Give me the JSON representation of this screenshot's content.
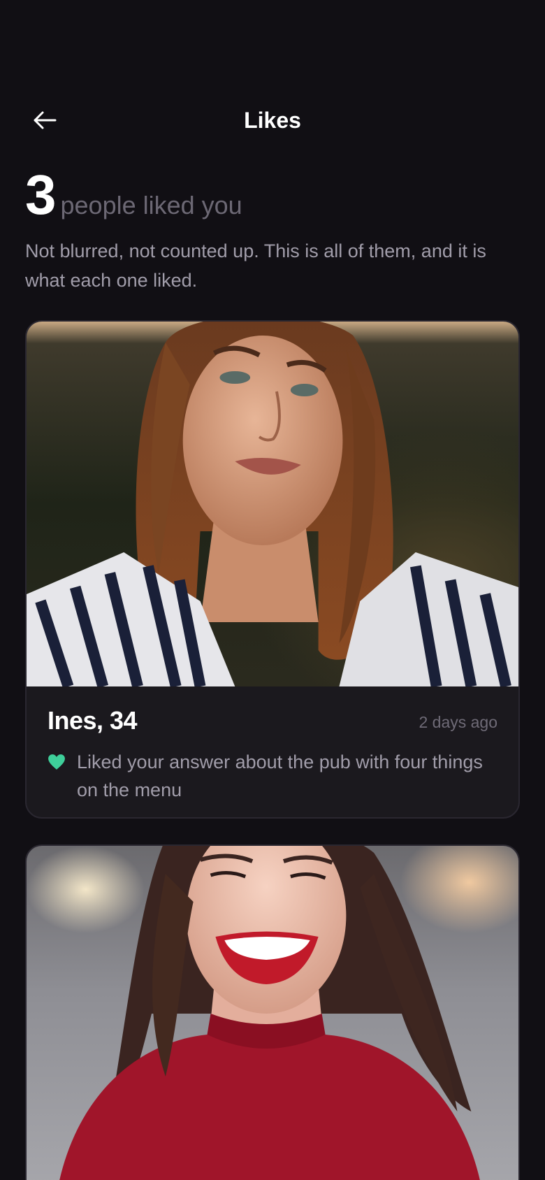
{
  "header": {
    "title": "Likes",
    "back_icon": "arrow-left-icon"
  },
  "intro": {
    "count": "3",
    "count_label": "people liked you",
    "description": "Not blurred, not counted up. This is all of them, and it is what each one liked."
  },
  "likes": [
    {
      "name": "Ines, 34",
      "time": "2 days ago",
      "liked": "Liked your answer about the pub with four things on the menu",
      "heart_color": "#3ecf9a"
    },
    {
      "name": "",
      "time": "",
      "liked": ""
    }
  ],
  "colors": {
    "background": "#110f14",
    "card": "#1b191e",
    "accent": "#3ecf9a",
    "muted": "#a19daa"
  }
}
